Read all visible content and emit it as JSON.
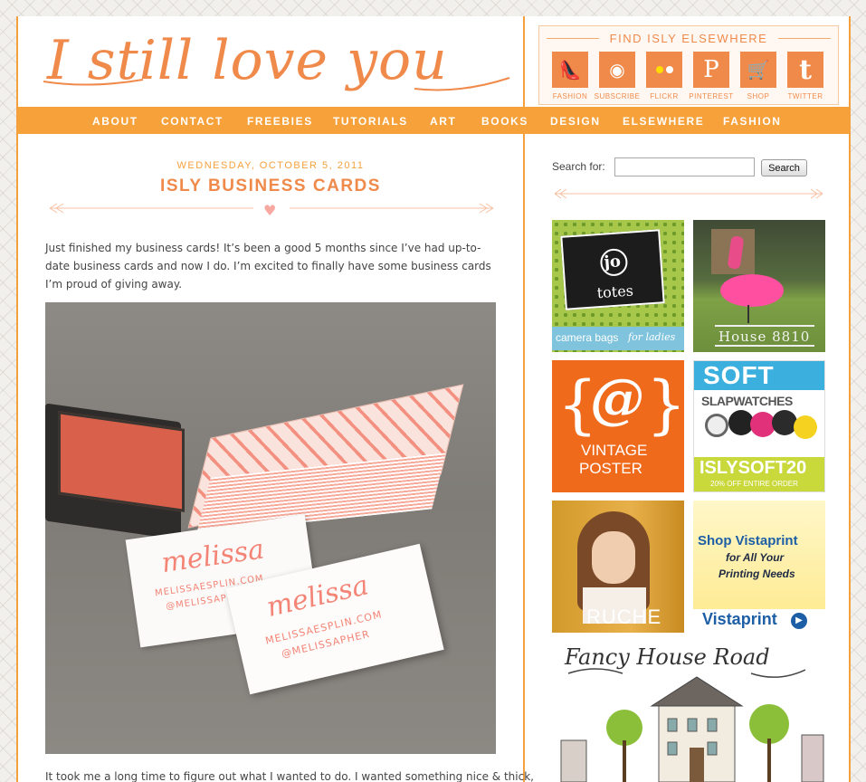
{
  "header": {
    "logo_text": "I still love you",
    "elsewhere_title": "FIND ISLY ELSEWHERE",
    "social": [
      {
        "label": "FASHION",
        "icon": "shoe-icon",
        "glyph": "👠"
      },
      {
        "label": "SUBSCRIBE",
        "icon": "rss-icon",
        "glyph": "◉"
      },
      {
        "label": "FLICKR",
        "icon": "flickr-icon",
        "glyph": "●●"
      },
      {
        "label": "PINTEREST",
        "icon": "pinterest-icon",
        "glyph": "P"
      },
      {
        "label": "SHOP",
        "icon": "cart-icon",
        "glyph": "🛒"
      },
      {
        "label": "TWITTER",
        "icon": "twitter-icon",
        "glyph": "t"
      }
    ]
  },
  "nav": {
    "items": [
      "ABOUT",
      "CONTACT",
      "FREEBIES",
      "TUTORIALS",
      "ART",
      "BOOKS",
      "DESIGN",
      "ELSEWHERE",
      "FASHION"
    ]
  },
  "post": {
    "date": "WEDNESDAY, OCTOBER 5, 2011",
    "title": "ISLY BUSINESS CARDS",
    "body": "Just finished my business cards! It’s been a good 5 months since I’ve had up-to-date business cards and now I do. I’m excited to finally have some business cards I’m proud of giving away.",
    "card_name": "melissa",
    "card_site": "MELISSAESPLIN.COM",
    "card_handle": "@MELISSAPHER",
    "body_2": "It took me a long time to figure out what I wanted to do. I wanted something nice & thick,"
  },
  "sidebar": {
    "search_label": "Search for:",
    "search_value": "",
    "search_button": "Search",
    "ads": {
      "jo_totes": {
        "logo_top": "jo",
        "logo_bottom": "totes",
        "tagline": "camera bags",
        "tagline_em": "for ladies"
      },
      "house": {
        "label": "House 8810"
      },
      "vintage": {
        "logo": "@",
        "line1": "VINTAGE",
        "line2": "POSTER"
      },
      "soft": {
        "brand": "SOFT",
        "sub": "SLAPWATCHES",
        "code": "ISLYSOFT20",
        "offer": "20% OFF ENTIRE ORDER"
      },
      "ruche": {
        "label": "RUCHE"
      },
      "vistaprint": {
        "line1": "Shop Vistaprint",
        "line2": "for All Your",
        "line3": "Printing Needs",
        "brand": "Vistaprint"
      },
      "fancy": {
        "title": "Fancy House Road"
      }
    }
  },
  "colors": {
    "accent": "#f08a4b",
    "nav_bg": "#f6a13a",
    "border": "#f4a13d"
  }
}
